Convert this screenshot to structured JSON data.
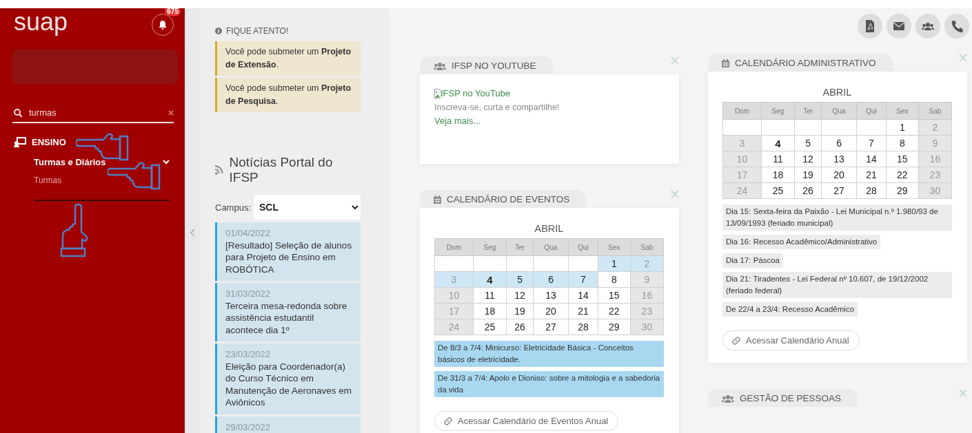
{
  "sidebar": {
    "logo": "suap",
    "notification_count": "675",
    "search": {
      "value": "turmas"
    },
    "menu": [
      {
        "label": "ENSINO",
        "children": [
          {
            "label": "Turmas e Diários",
            "expanded": true,
            "children": [
              {
                "label": "Turmas"
              }
            ]
          }
        ]
      }
    ]
  },
  "notices": {
    "title": "FIQUE ATENTO!",
    "items": [
      "Você pode submeter um **Projeto de Extensão**.",
      "Você pode submeter um **Projeto de Pesquisa**."
    ]
  },
  "news": {
    "title": "Notícias Portal do IFSP",
    "campus_label": "Campus:",
    "campus": "SCL",
    "items": [
      {
        "date": "01/04/2022",
        "title": "[Resultado] Seleção de alunos para Projeto de Ensino em ROBÓTICA"
      },
      {
        "date": "31/03/2022",
        "title": "Terceira mesa-redonda sobre assistência estudantil acontece dia 1º"
      },
      {
        "date": "23/03/2022",
        "title": "Eleição para Coordenador(a) do Curso Técnico em Manutenção de Aeronaves em Aviônicos"
      },
      {
        "date": "29/03/2022"
      }
    ]
  },
  "columns": [
    [
      {
        "kind": "youtube",
        "title": "IFSP NO YOUTUBE",
        "image_alt": "IFSP no YouTube",
        "subtitle": "Inscreva-se, curta e compartilhe!",
        "link": "Veja mais..."
      },
      {
        "kind": "events_calendar",
        "title": "CALENDÁRIO DE EVENTOS",
        "month": "ABRIL",
        "weekdays": [
          "Dom",
          "Seg",
          "Ter",
          "Qua",
          "Qui",
          "Sex",
          "Sab"
        ],
        "weeks": [
          [
            {
              "blank": true
            },
            {
              "blank": true
            },
            {
              "blank": true
            },
            {
              "blank": true
            },
            {
              "blank": true
            },
            {
              "d": "1",
              "event": true,
              "today": false
            },
            {
              "d": "2",
              "event": true,
              "today": false
            }
          ],
          [
            {
              "d": "3",
              "event": true,
              "today": false
            },
            {
              "d": "4",
              "event": true,
              "today": true
            },
            {
              "d": "5",
              "event": true,
              "today": false
            },
            {
              "d": "6",
              "event": true,
              "today": false
            },
            {
              "d": "7",
              "event": true,
              "today": false
            },
            {
              "d": "8",
              "event": false,
              "today": false
            },
            {
              "d": "9",
              "event": false,
              "today": false
            }
          ],
          [
            {
              "d": "10",
              "event": false,
              "today": false
            },
            {
              "d": "11",
              "event": false,
              "today": false
            },
            {
              "d": "12",
              "event": false,
              "today": false
            },
            {
              "d": "13",
              "event": false,
              "today": false
            },
            {
              "d": "14",
              "event": false,
              "today": false
            },
            {
              "d": "15",
              "event": false,
              "today": false
            },
            {
              "d": "16",
              "event": false,
              "today": false
            }
          ],
          [
            {
              "d": "17",
              "event": false,
              "today": false
            },
            {
              "d": "18",
              "event": false,
              "today": false
            },
            {
              "d": "19",
              "event": false,
              "today": false
            },
            {
              "d": "20",
              "event": false,
              "today": false
            },
            {
              "d": "21",
              "event": false,
              "today": false
            },
            {
              "d": "22",
              "event": false,
              "today": false
            },
            {
              "d": "23",
              "event": false,
              "today": false
            }
          ],
          [
            {
              "d": "24",
              "event": false,
              "today": false
            },
            {
              "d": "25",
              "event": false,
              "today": false
            },
            {
              "d": "26",
              "event": false,
              "today": false
            },
            {
              "d": "27",
              "event": false,
              "today": false
            },
            {
              "d": "28",
              "event": false,
              "today": false
            },
            {
              "d": "29",
              "event": false,
              "today": false
            },
            {
              "d": "30",
              "event": false,
              "today": false
            }
          ]
        ],
        "events": [
          "De 8/3 a 7/4: Minicurso: Eletricidade Básica - Conceitos básicos de eletricidade.",
          "De 31/3 a 7/4: Apolo e Dioniso: sobre a mitologia e a sabedoria da vida"
        ],
        "button": "Acessar Calendário de Eventos Anual"
      }
    ],
    [
      {
        "kind": "admin_calendar",
        "title": "CALENDÁRIO ADMINISTRATIVO",
        "month": "ABRIL",
        "weekdays": [
          "Dom",
          "Seg",
          "Ter",
          "Qua",
          "Qui",
          "Sex",
          "Sab"
        ],
        "weeks": [
          [
            {
              "blank": true
            },
            {
              "blank": true
            },
            {
              "blank": true
            },
            {
              "blank": true
            },
            {
              "blank": true
            },
            {
              "d": "1",
              "event": false,
              "today": false
            },
            {
              "d": "2",
              "event": false,
              "today": false
            }
          ],
          [
            {
              "d": "3",
              "event": false,
              "today": false
            },
            {
              "d": "4",
              "event": false,
              "today": true
            },
            {
              "d": "5",
              "event": false,
              "today": false
            },
            {
              "d": "6",
              "event": false,
              "today": false
            },
            {
              "d": "7",
              "event": false,
              "today": false
            },
            {
              "d": "8",
              "event": false,
              "today": false
            },
            {
              "d": "9",
              "event": false,
              "today": false
            }
          ],
          [
            {
              "d": "10",
              "event": false,
              "today": false
            },
            {
              "d": "11",
              "event": false,
              "today": false
            },
            {
              "d": "12",
              "event": false,
              "today": false
            },
            {
              "d": "13",
              "event": false,
              "today": false
            },
            {
              "d": "14",
              "event": false,
              "today": false
            },
            {
              "d": "15",
              "event": false,
              "today": false
            },
            {
              "d": "16",
              "event": false,
              "today": false
            }
          ],
          [
            {
              "d": "17",
              "event": false,
              "today": false
            },
            {
              "d": "18",
              "event": false,
              "today": false
            },
            {
              "d": "19",
              "event": false,
              "today": false
            },
            {
              "d": "20",
              "event": false,
              "today": false
            },
            {
              "d": "21",
              "event": false,
              "today": false
            },
            {
              "d": "22",
              "event": false,
              "today": false
            },
            {
              "d": "23",
              "event": false,
              "today": false
            }
          ],
          [
            {
              "d": "24",
              "event": false,
              "today": false
            },
            {
              "d": "25",
              "event": false,
              "today": false
            },
            {
              "d": "26",
              "event": false,
              "today": false
            },
            {
              "d": "27",
              "event": false,
              "today": false
            },
            {
              "d": "28",
              "event": false,
              "today": false
            },
            {
              "d": "29",
              "event": false,
              "today": false
            },
            {
              "d": "30",
              "event": false,
              "today": false
            }
          ]
        ],
        "events": [
          "Dia 15: Sexta-feira da Paixão - Lei Municipal n.º 1.980/93 de 13/09/1993 (feriado municipal)",
          "Dia 16: Recesso Acadêmico/Administrativo",
          "Dia 17: Páscoa",
          "Dia 21: Tiradentes - Lei Federal nº 10.607, de 19/12/2002 (feriado federal)",
          "De 22/4 a 23/4: Recesso Acadêmico"
        ],
        "button": "Acessar Calendário Anual"
      },
      {
        "kind": "people",
        "title": "GESTÃO DE PESSOAS"
      }
    ]
  ]
}
